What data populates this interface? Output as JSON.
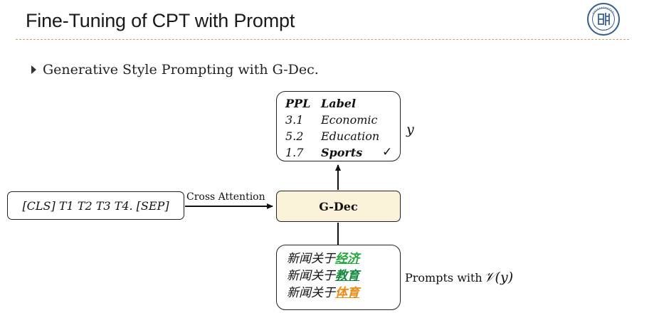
{
  "slide": {
    "title": "Fine-Tuning of CPT with Prompt"
  },
  "bullet": {
    "text": "Generative Style Prompting with G-Dec."
  },
  "label_box": {
    "headers": [
      "PPL",
      "Label"
    ],
    "rows": [
      {
        "ppl": "3.1",
        "label": "Economic"
      },
      {
        "ppl": "5.2",
        "label": "Education"
      },
      {
        "ppl": "1.7",
        "label": "Sports",
        "check": "✓"
      }
    ]
  },
  "y_label": "y",
  "input": {
    "text": "[CLS] T1 T2 T3 T4. [SEP]"
  },
  "cross_attention_label": "Cross Attention",
  "gdec_label": "G-Dec",
  "prompts": {
    "rows": [
      {
        "prefix": "新闻关于",
        "word": "经济",
        "color": "#1fa83a"
      },
      {
        "prefix": "新闻关于",
        "word": "教育",
        "color": "#0f8a3a"
      },
      {
        "prefix": "新闻关于",
        "word": "体育",
        "color": "#ee8a12"
      }
    ],
    "side_label": "Prompts with",
    "side_math": "𝒱(y)"
  },
  "colors": {
    "title_rule": "#c6a56a",
    "gdec_fill": "#fbf2da",
    "logo": "#3a5f96"
  }
}
